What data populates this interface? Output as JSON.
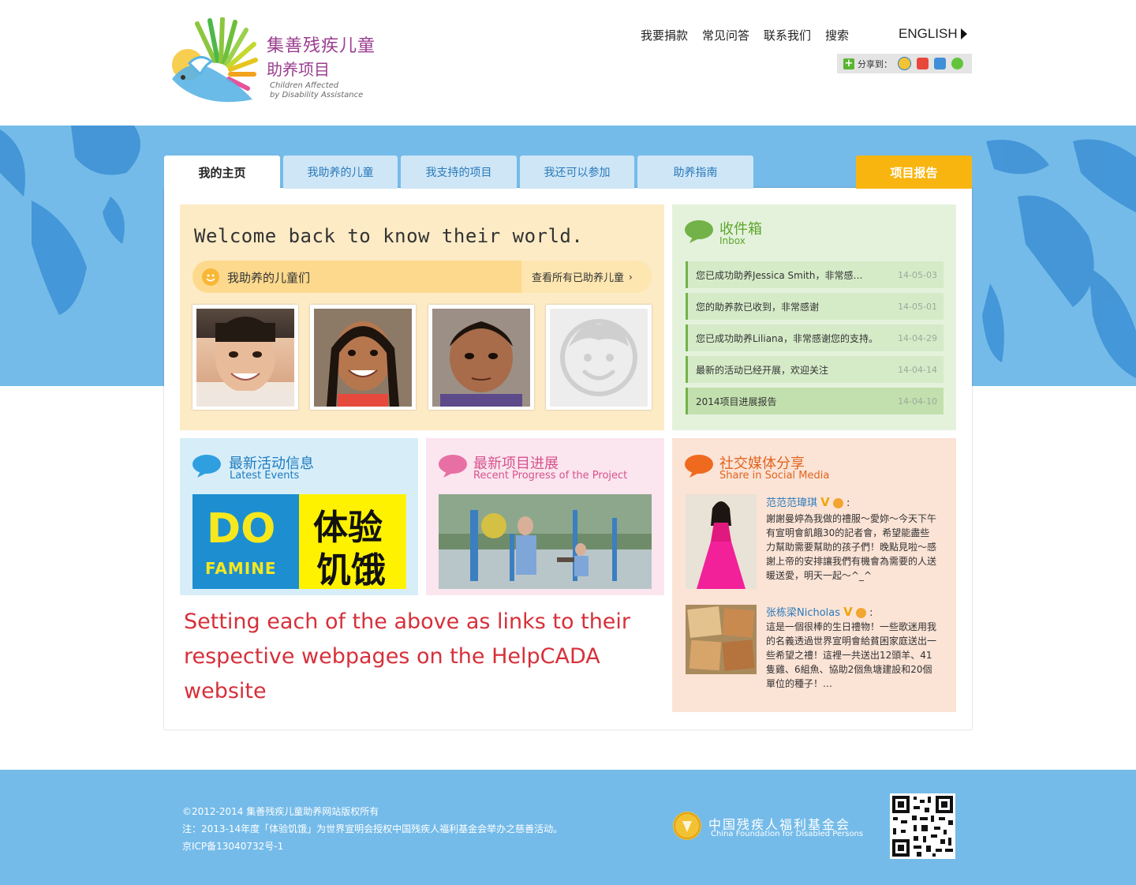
{
  "logo": {
    "cn_line1": "集善残疾儿童",
    "cn_line2": "助养项目",
    "en_line1": "Children Affected",
    "en_line2": "by Disability Assistance"
  },
  "topnav": {
    "items": [
      "我要捐款",
      "常见问答",
      "联系我们",
      "搜索"
    ],
    "language": "ENGLISH"
  },
  "share": {
    "label": "分享到：",
    "icons": [
      "qzone-icon",
      "weibo-icon",
      "tencent-weibo-icon",
      "wechat-icon"
    ]
  },
  "tabs": [
    {
      "label": "我的主页",
      "active": true
    },
    {
      "label": "我助养的儿童",
      "active": false
    },
    {
      "label": "我支持的项目",
      "active": false
    },
    {
      "label": "我还可以参加",
      "active": false
    },
    {
      "label": "助养指南",
      "active": false
    }
  ],
  "report_tab": "项目报告",
  "welcome": {
    "title": "Welcome back to know their world.",
    "kids_label": "我助养的儿童们",
    "kids_more": "查看所有已助养儿童"
  },
  "inbox": {
    "title": "收件箱",
    "subtitle": "Inbox",
    "messages": [
      {
        "text": "您已成功助养Jessica Smith，非常感…",
        "date": "14-05-03"
      },
      {
        "text": "您的助养款已收到，非常感谢",
        "date": "14-05-01"
      },
      {
        "text": "您已成功助养Liliana，非常感谢您的支持。",
        "date": "14-04-29"
      },
      {
        "text": "最新的活动已经开展，欢迎关注",
        "date": "14-04-14"
      },
      {
        "text": "2014项目进展报告",
        "date": "14-04-10"
      }
    ]
  },
  "events": {
    "title": "最新活动信息",
    "subtitle": "Latest Events",
    "banner_left": "DO",
    "banner_left_sub": "FAMINE",
    "banner_right1": "体验",
    "banner_right2": "饥饿"
  },
  "progress": {
    "title": "最新项目进展",
    "subtitle": "Recent Progress of the Project"
  },
  "social": {
    "title": "社交媒体分享",
    "subtitle": "Share in Social Media",
    "posts": [
      {
        "name": "范范范瑋琪",
        "text": "謝謝曼婷為我做的禮服～愛妳～今天下午有宣明會飢餓30的記者會，希望能盡些力幫助需要幫助的孩子們！晚點見啦～感謝上帝的安排讓我們有機會為需要的人送暖送愛，明天一起～^_^"
      },
      {
        "name": "张栋梁Nicholas",
        "text": "這是一個很棒的生日禮物！一些歌迷用我的名義透過世界宣明會給貧困家庭送出一些希望之禮！這裡一共送出12頭羊、41隻雞、6組魚、協助2個魚塘建設和20個單位的種子！…"
      }
    ]
  },
  "annotation": {
    "line1": "Setting each of the above as links to their",
    "line2": "respective webpages on the HelpCADA website"
  },
  "footer": {
    "line1": "©2012-2014 集善残疾儿童助养网站版权所有",
    "line2": "注：2013-14年度「体验饥饿」为世界宣明会授权中国残疾人福利基金会举办之慈善活动。",
    "line3": "京ICP备13040732号-1",
    "org_cn": "中国残疾人福利基金会",
    "org_en": "China Foundation for Disabled Persons"
  },
  "colors": {
    "sky_blue": "#74bbe9",
    "tab_blue": "#cfe6f7",
    "report_yellow": "#f9b50f",
    "inbox_green": "#5da52c",
    "annotation_red": "#d6303a"
  }
}
